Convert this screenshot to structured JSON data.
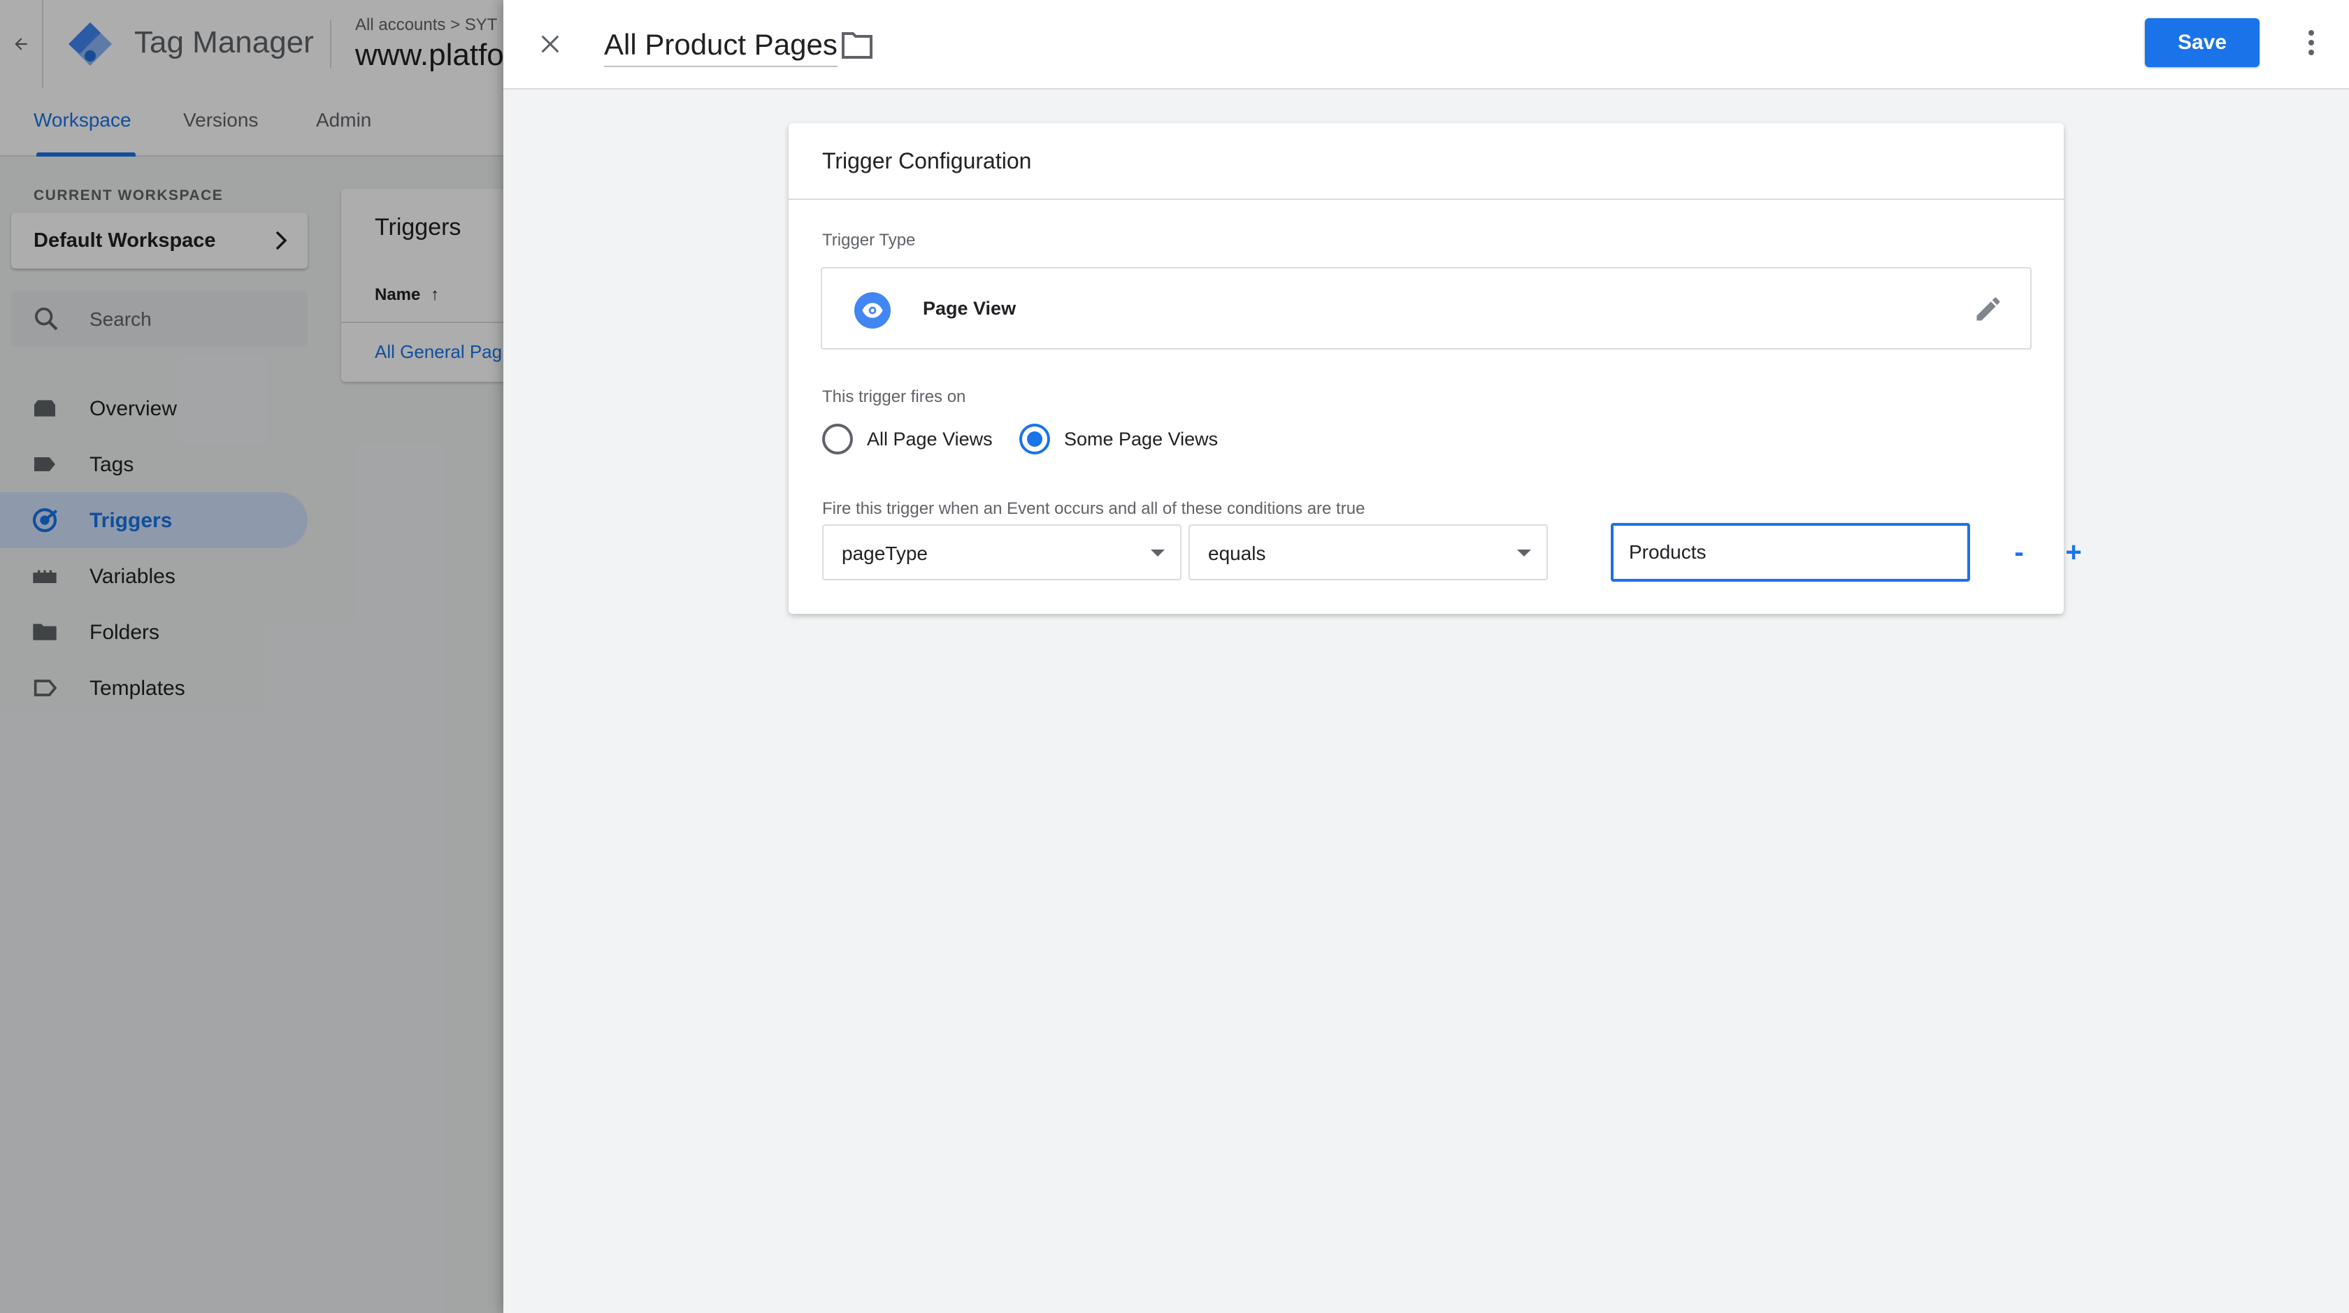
{
  "app": {
    "product_name": "Tag Manager",
    "breadcrumb": "All accounts  >  SYT",
    "container_name": "www.platfo",
    "nav_tabs": [
      {
        "label": "Workspace",
        "active": true
      },
      {
        "label": "Versions",
        "active": false
      },
      {
        "label": "Admin",
        "active": false
      }
    ],
    "workspace": {
      "label": "CURRENT WORKSPACE",
      "name": "Default Workspace"
    },
    "search": {
      "placeholder": "Search"
    },
    "sidebar": {
      "items": [
        {
          "label": "Overview",
          "icon": "overview-icon",
          "active": false
        },
        {
          "label": "Tags",
          "icon": "tag-icon",
          "active": false
        },
        {
          "label": "Triggers",
          "icon": "trigger-icon",
          "active": true
        },
        {
          "label": "Variables",
          "icon": "variables-icon",
          "active": false
        },
        {
          "label": "Folders",
          "icon": "folder-icon",
          "active": false
        },
        {
          "label": "Templates",
          "icon": "templates-icon",
          "active": false
        }
      ]
    },
    "list": {
      "title": "Triggers",
      "column": "Name",
      "rows": [
        "All General Pag"
      ]
    }
  },
  "panel": {
    "title": "All Product Pages",
    "save_label": "Save",
    "card_title": "Trigger Configuration",
    "trigger_type_label": "Trigger Type",
    "trigger_type": "Page View",
    "fires_on_label": "This trigger fires on",
    "fires_on_options": [
      {
        "label": "All Page Views",
        "checked": false
      },
      {
        "label": "Some Page Views",
        "checked": true
      }
    ],
    "conditions_label": "Fire this trigger when an Event occurs and all of these conditions are true",
    "condition": {
      "variable": "pageType",
      "operator": "equals",
      "value": "Products"
    },
    "remove_label": "-",
    "add_label": "+"
  },
  "colors": {
    "accent": "#1a73e8",
    "scrim": "rgba(0,0,0,0.32)",
    "active_nav_bg": "#d2e3fc"
  }
}
